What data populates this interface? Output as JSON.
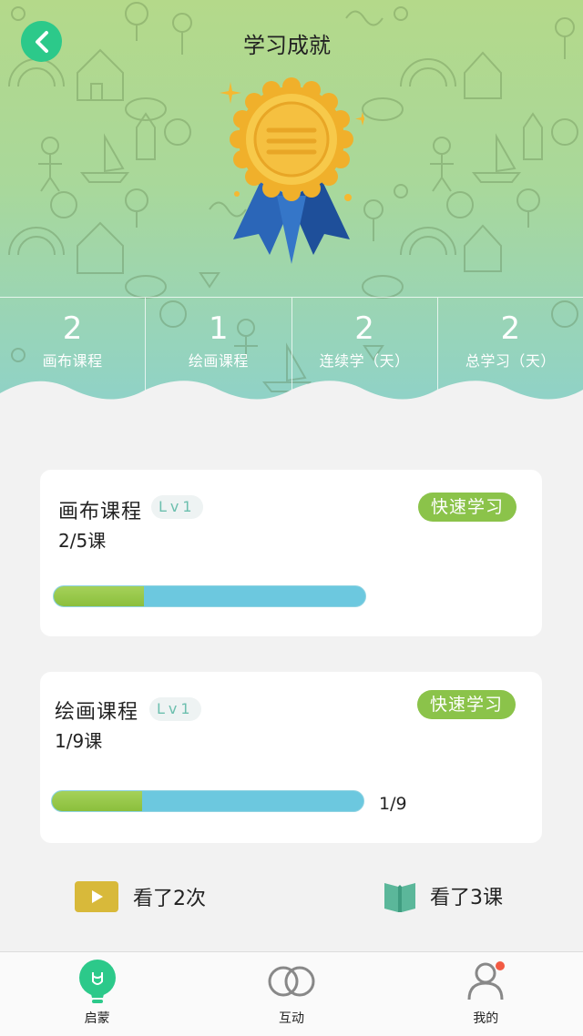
{
  "header": {
    "title": "学习成就",
    "back_icon": "chevron-left-icon",
    "medal_icon": "medal-icon"
  },
  "stats": [
    {
      "value": "2",
      "label": "画布课程"
    },
    {
      "value": "1",
      "label": "绘画课程"
    },
    {
      "value": "2",
      "label": "连续学（天）"
    },
    {
      "value": "2",
      "label": "总学习（天）"
    }
  ],
  "courses": [
    {
      "title": "画布课程",
      "level": "Lv1",
      "progress_text": "2/5课",
      "button_label": "快速学习",
      "progress_fraction": 0.29,
      "bar_label": ""
    },
    {
      "title": "绘画课程",
      "level": "Lv1",
      "progress_text": "1/9课",
      "button_label": "快速学习",
      "progress_fraction": 0.29,
      "bar_label": "1/9"
    }
  ],
  "summary": {
    "watched_times": "看了2次",
    "watched_lessons": "看了3课"
  },
  "nav": {
    "items": [
      {
        "label": "启蒙",
        "icon": "bulb-icon",
        "active": true
      },
      {
        "label": "互动",
        "icon": "rings-icon",
        "active": false
      },
      {
        "label": "我的",
        "icon": "user-icon",
        "active": false
      }
    ]
  },
  "colors": {
    "accent_green": "#2cc98a",
    "button_green": "#8bc34a",
    "bar_blue": "#6cc8df",
    "lv_text": "#6cbfae",
    "notify_red": "#f25a43"
  }
}
